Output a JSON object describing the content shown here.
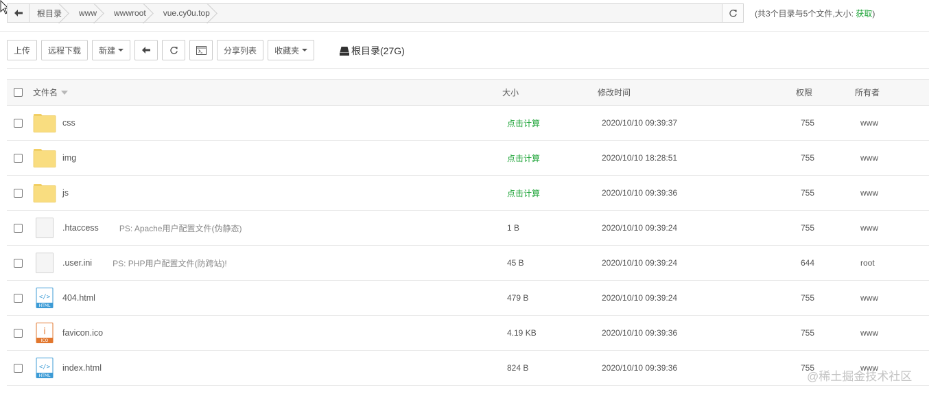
{
  "path": {
    "crumbs": [
      "根目录",
      "www",
      "wwwroot",
      "vue.cy0u.top"
    ],
    "summary_prefix": "(共3个目录与5个文件,大小: ",
    "summary_fetch": "获取",
    "summary_suffix": ")"
  },
  "toolbar": {
    "upload": "上传",
    "remote_download": "远程下载",
    "new": "新建",
    "share_list": "分享列表",
    "favorites": "收藏夹",
    "disk": "根目录(27G)"
  },
  "table": {
    "headers": {
      "name": "文件名",
      "size": "大小",
      "mtime": "修改时间",
      "perm": "权限",
      "owner": "所有者"
    },
    "rows": [
      {
        "name": "css",
        "icon": "folder-icon",
        "note": "",
        "size": "点击计算",
        "mtime": "2020/10/10 09:39:37",
        "perm": "755",
        "owner": "www"
      },
      {
        "name": "img",
        "icon": "folder-icon",
        "note": "",
        "size": "点击计算",
        "mtime": "2020/10/10 18:28:51",
        "perm": "755",
        "owner": "www"
      },
      {
        "name": "js",
        "icon": "folder-icon",
        "note": "",
        "size": "点击计算",
        "mtime": "2020/10/10 09:39:36",
        "perm": "755",
        "owner": "www"
      },
      {
        "name": ".htaccess",
        "icon": "file-icon",
        "note": "PS: Apache用户配置文件(伪静态)",
        "size": "1 B",
        "mtime": "2020/10/10 09:39:24",
        "perm": "755",
        "owner": "www"
      },
      {
        "name": ".user.ini",
        "icon": "file-icon",
        "note": "PS: PHP用户配置文件(防跨站)!",
        "size": "45 B",
        "mtime": "2020/10/10 09:39:24",
        "perm": "644",
        "owner": "root"
      },
      {
        "name": "404.html",
        "icon": "html-file-icon",
        "note": "",
        "size": "479 B",
        "mtime": "2020/10/10 09:39:24",
        "perm": "755",
        "owner": "www"
      },
      {
        "name": "favicon.ico",
        "icon": "ico-file-icon",
        "note": "",
        "size": "4.19 KB",
        "mtime": "2020/10/10 09:39:36",
        "perm": "755",
        "owner": "www"
      },
      {
        "name": "index.html",
        "icon": "html-file-icon",
        "note": "",
        "size": "824 B",
        "mtime": "2020/10/10 09:39:36",
        "perm": "755",
        "owner": "www"
      }
    ]
  },
  "icon_labels": {
    "html": "HTML",
    "ico": "ICO",
    "ico_glyph": "i",
    "html_glyph": "</>"
  },
  "watermark": "@稀土掘金技术社区",
  "colors": {
    "accent_green": "#20a53a",
    "folder_fill": "#f9dd80",
    "html_blue": "#3c9bd6",
    "ico_orange": "#e2772e"
  }
}
